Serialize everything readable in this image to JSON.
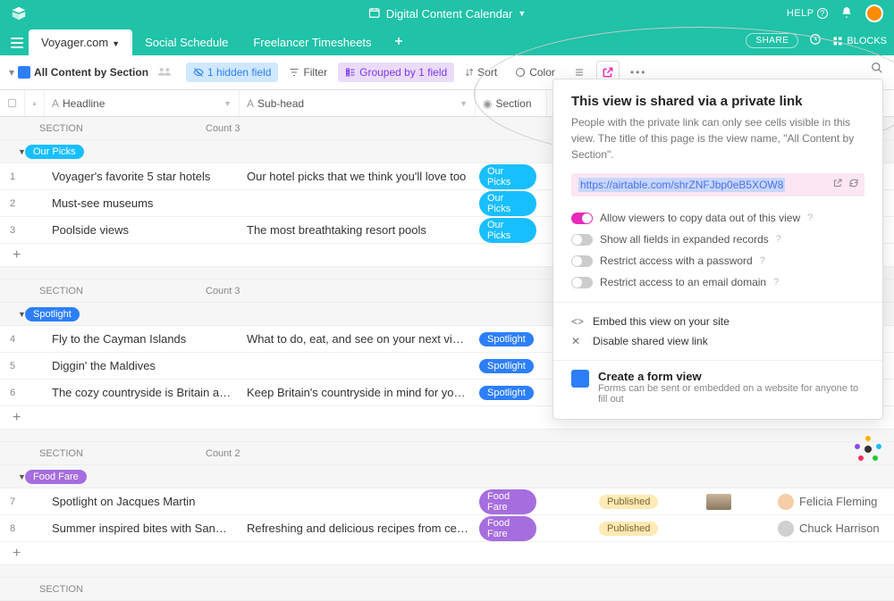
{
  "header": {
    "base_title": "Digital Content Calendar",
    "help": "HELP"
  },
  "tabs": {
    "items": [
      {
        "label": "Voyager.com",
        "active": true
      },
      {
        "label": "Social Schedule",
        "active": false
      },
      {
        "label": "Freelancer Timesheets",
        "active": false
      }
    ],
    "share": "SHARE",
    "blocks": "BLOCKS"
  },
  "toolbar": {
    "view_name": "All Content by Section",
    "hidden_fields": "1 hidden field",
    "filter": "Filter",
    "grouped": "Grouped by 1 field",
    "sort": "Sort",
    "color": "Color"
  },
  "columns": {
    "headline": "Headline",
    "subhead": "Sub-head",
    "section": "Section"
  },
  "group_labels": {
    "section": "SECTION",
    "count": "Count"
  },
  "groups": [
    {
      "pill": "Our Picks",
      "pill_class": "blue",
      "count": "3",
      "rows": [
        {
          "n": "1",
          "headline": "Voyager's favorite 5 star hotels",
          "sub": "Our hotel picks that we think you'll love too",
          "sect": "Our Picks"
        },
        {
          "n": "2",
          "headline": "Must-see museums",
          "sub": "",
          "sect": "Our Picks"
        },
        {
          "n": "3",
          "headline": "Poolside views",
          "sub": "The most breathtaking resort pools",
          "sect": "Our Picks"
        }
      ]
    },
    {
      "pill": "Spotlight",
      "pill_class": "blue2",
      "count": "3",
      "rows": [
        {
          "n": "4",
          "headline": "Fly to the Cayman Islands",
          "sub": "What to do, eat, and see on your next visit to the Cayma...",
          "sect": "Spotlight"
        },
        {
          "n": "5",
          "headline": "Diggin' the Maldives",
          "sub": "",
          "sect": "Spotlight"
        },
        {
          "n": "6",
          "headline": "The cozy countryside is Britain at its best",
          "sub": "Keep Britain's countryside in mind for your next vacation",
          "sect": "Spotlight"
        }
      ]
    },
    {
      "pill": "Food Fare",
      "pill_class": "purple",
      "count": "2",
      "rows": [
        {
          "n": "7",
          "headline": "Spotlight on Jacques Martin",
          "sub": "",
          "sect": "Food Fare",
          "status": "Published",
          "author": "Felicia Fleming",
          "avatar": "peach",
          "img": true
        },
        {
          "n": "8",
          "headline": "Summer inspired bites with Sandra Key",
          "sub": "Refreshing and delicious recipes from celebrated chef, S...",
          "sect": "Food Fare",
          "status": "Published",
          "author": "Chuck Harrison",
          "avatar": "gray",
          "img": false
        }
      ]
    }
  ],
  "popover": {
    "title": "This view is shared via a private link",
    "desc": "People with the private link can only see cells visible in this view. The title of this page is the view name, \"All Content by Section\".",
    "link": "https://airtable.com/shrZNFJbp0eB5XOW8",
    "options": [
      {
        "label": "Allow viewers to copy data out of this view",
        "on": true
      },
      {
        "label": "Show all fields in expanded records",
        "on": false
      },
      {
        "label": "Restrict access with a password",
        "on": false
      },
      {
        "label": "Restrict access to an email domain",
        "on": false
      }
    ],
    "embed": "Embed this view on your site",
    "disable": "Disable shared view link",
    "form_title": "Create a form view",
    "form_desc": "Forms can be sent or embedded on a website for anyone to fill out"
  }
}
